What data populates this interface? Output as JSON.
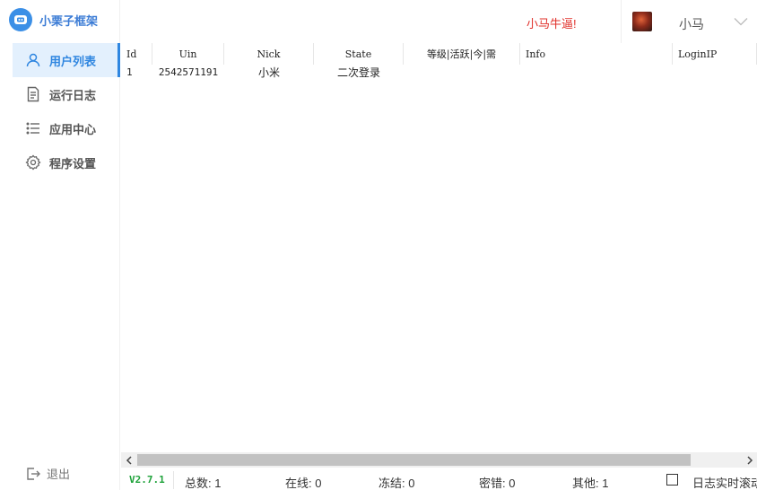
{
  "brand": {
    "title": "小栗子框架"
  },
  "sidebar": {
    "items": [
      {
        "label": "用户列表",
        "icon": "user-icon",
        "active": true
      },
      {
        "label": "运行日志",
        "icon": "document-icon",
        "active": false
      },
      {
        "label": "应用中心",
        "icon": "list-icon",
        "active": false
      },
      {
        "label": "程序设置",
        "icon": "gear-icon",
        "active": false
      }
    ],
    "logout_label": "退出"
  },
  "header": {
    "slogan": "小马牛逼!",
    "username": "小马"
  },
  "table": {
    "columns": [
      "Id",
      "Uin",
      "Nick",
      "State",
      "等级|活跃|今|需",
      "Info",
      "LoginIP"
    ],
    "rows": [
      [
        "1",
        "2542571191",
        "小米",
        "二次登录",
        "",
        "",
        ""
      ]
    ]
  },
  "status": {
    "version": "V2.7.1",
    "total": "总数: 1",
    "online": "在线: 0",
    "frozen": "冻结: 0",
    "password_error": "密错: 0",
    "other": "其他: 1",
    "log_scroll_label": "日志实时滚动",
    "log_scroll_checked": false
  },
  "colors": {
    "accent": "#2f86e0",
    "active_bg": "#e3f0fd",
    "slogan": "#e0302a",
    "version": "#1ea23a"
  }
}
